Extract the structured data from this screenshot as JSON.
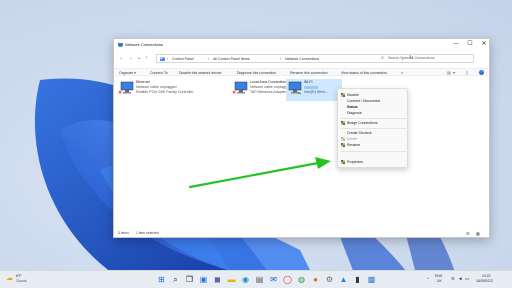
{
  "window": {
    "title": "Network Connections",
    "controls": {
      "minimize": "─",
      "maximize": "☐",
      "close": "✕"
    }
  },
  "nav": {
    "back": "←",
    "forward": "→",
    "recent": "⌄",
    "up": "↑"
  },
  "breadcrumb": [
    "Control Panel",
    "All Control Panel Items",
    "Network Connections"
  ],
  "breadcrumb_sep": "›",
  "address_dropdown": "⌄",
  "refresh": "↻",
  "search": {
    "placeholder": "Search Network Connections"
  },
  "toolbar": {
    "items": [
      "Organize ▾",
      "Connect To",
      "Disable this network device",
      "Diagnose this connection",
      "Rename this connection",
      "View status of this connection"
    ],
    "overflow": "»",
    "view_icon": "▤",
    "view_dropdown": "▾",
    "pane_icon": "▯",
    "help_icon": "?"
  },
  "adapters": [
    {
      "name": "Ethernet",
      "status": "Network cable unplugged",
      "device": "Realtek PCIe GbE Family Controller",
      "disconnected": true
    },
    {
      "name": "Local Area Connection",
      "status": "Network cable unplugged",
      "device": "TAP-Windows Adapter V9 for Ope...",
      "disconnected": true
    },
    {
      "name": "Wi-Fi",
      "status": "",
      "device": "Intel(R) Wirel...",
      "disconnected": false
    }
  ],
  "context_menu": [
    {
      "label": "Disable",
      "icon": "shield-icon",
      "style": "normal"
    },
    {
      "label": "Connect / Disconnect",
      "icon": "",
      "style": "normal"
    },
    {
      "label": "Status",
      "icon": "",
      "style": "bold"
    },
    {
      "label": "Diagnose",
      "icon": "",
      "style": "normal"
    },
    {
      "label": "Bridge Connections",
      "icon": "shield-icon",
      "style": "normal"
    },
    {
      "label": "Create Shortcut",
      "icon": "",
      "style": "normal"
    },
    {
      "label": "Delete",
      "icon": "shield-icon",
      "style": "disabled"
    },
    {
      "label": "Rename",
      "icon": "shield-icon",
      "style": "normal"
    },
    {
      "label": "Properties",
      "icon": "shield-icon",
      "style": "normal"
    }
  ],
  "statusbar": {
    "count": "3 items",
    "selected": "1 item selected"
  },
  "taskbar": {
    "weather_temp": "8°F",
    "weather_desc": "Clouds",
    "icons": [
      "windows-start-icon",
      "search-icon",
      "task-view-icon",
      "widgets-icon",
      "chat-icon",
      "file-explorer-icon",
      "edge-icon",
      "store-icon",
      "mail-icon",
      "opera-icon",
      "chrome-icon",
      "firefox-icon",
      "settings-icon",
      "photos-icon",
      "terminal-icon",
      "control-panel-icon"
    ],
    "tray_up": "^",
    "lang": "ENG",
    "lang_sub": "UK",
    "wifi": "📶",
    "volume": "🔊",
    "battery": "▭",
    "time": "13:22",
    "date": "18/09/2022"
  },
  "colors": {
    "accent": "#0067c0",
    "selection": "#cde8ff",
    "arrow": "#22c322",
    "shield_blue": "#2a6fd6",
    "shield_yellow": "#f2c200"
  }
}
